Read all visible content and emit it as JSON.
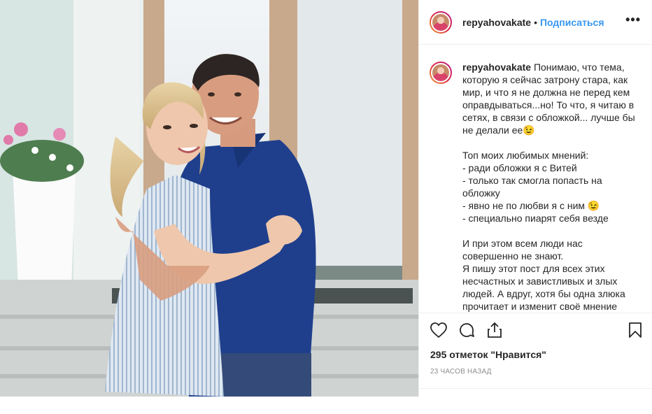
{
  "post": {
    "username": "repyahovakate",
    "separator": "•",
    "follow_label": "Подписаться",
    "more_label": "•••",
    "caption": {
      "username": "repyahovakate",
      "text": "Понимаю, что тема, которую я сейчас затрону стара, как мир, и что я не должна не перед кем оправдываться...но! То что, я читаю в сетях, в связи с обложкой... лучше бы не делали ее😉\n\nТоп моих любимых мнений:\n- ради обложки я с Витей\n- только так смогла попасть на обложку\n- явно не по любви я с ним 😉\n- специально пиарят себя везде\n\nИ при этом всем люди нас совершенно не знают.\nЯ пишу этот пост для всех этих несчастных и завистливых и злых людей. А вдруг, хотя бы одна злюка прочитает и изменит своё мнение"
    },
    "icons": [
      "heart-icon",
      "comment-icon",
      "share-icon",
      "bookmark-icon"
    ],
    "likes": "295 отметок \"Нравится\"",
    "timestamp": "23 часов назад",
    "colors": {
      "link": "#3897f0",
      "text": "#262626",
      "muted": "#8e8e8e",
      "border": "#efefef"
    }
  }
}
